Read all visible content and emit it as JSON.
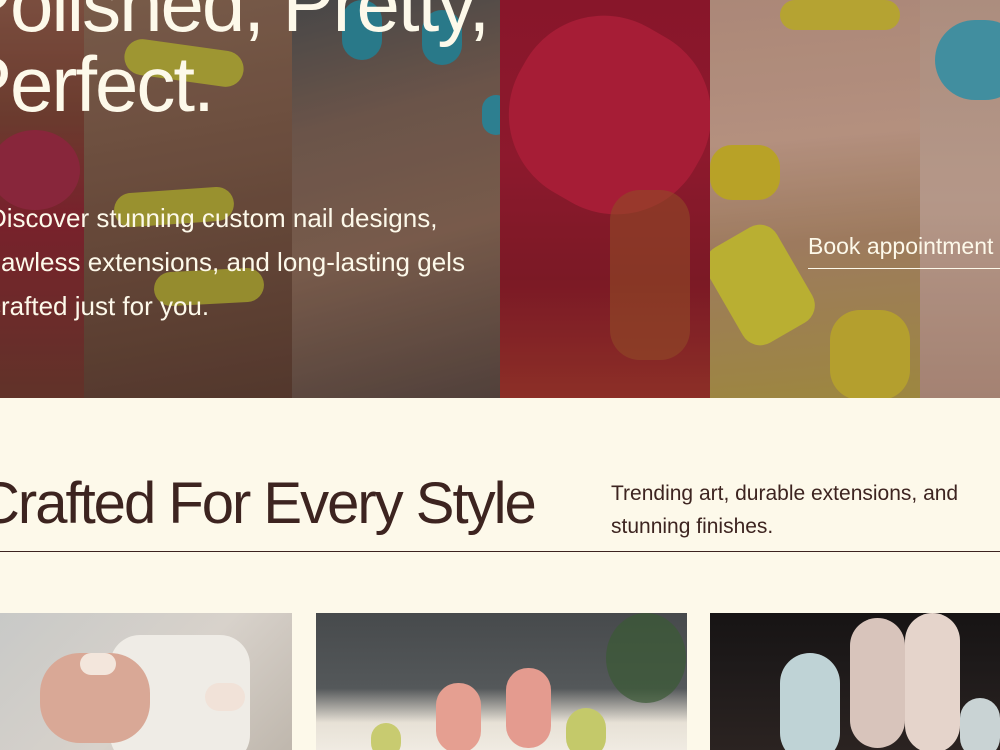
{
  "hero": {
    "title_line1": "Polished, Pretty,",
    "title_line2": "Perfect.",
    "description_lines": [
      "Discover stunning custom nail designs,",
      "flawless extensions, and long-lasting gels",
      "crafted just for you."
    ],
    "book_label": "Book appointment"
  },
  "section": {
    "title": "Crafted For Every Style",
    "description_lines": [
      "Trending art, durable extensions, and",
      "stunning finishes."
    ]
  },
  "colors": {
    "cream_background": "#fdf9ea",
    "dark_text": "#3d2420",
    "hero_text": "#fdf9ea"
  },
  "icons": []
}
